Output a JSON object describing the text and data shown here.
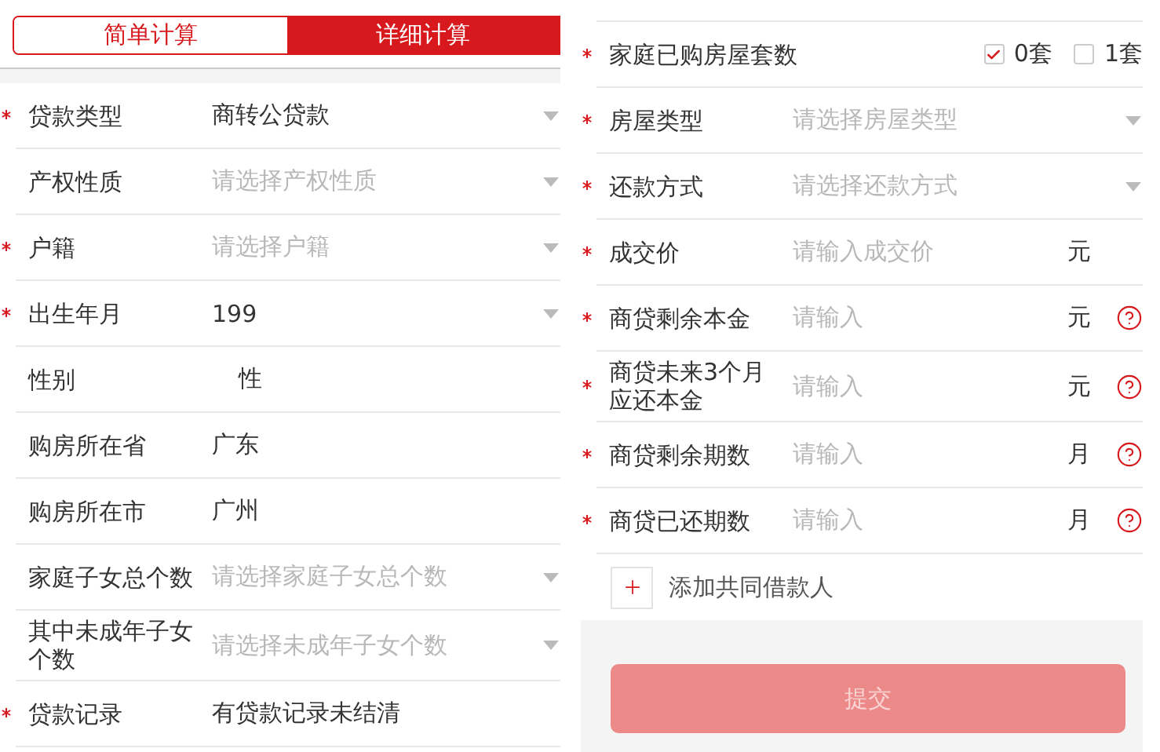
{
  "tabs": [
    {
      "label": "简单计算",
      "selected": false
    },
    {
      "label": "详细计算",
      "selected": true
    }
  ],
  "left_fields": [
    {
      "kind": "select",
      "required": true,
      "label": "贷款类型",
      "value": "商转公贷款",
      "arrow": true
    },
    {
      "kind": "select",
      "required": false,
      "label": "产权性质",
      "placeholder": "请选择产权性质",
      "arrow": true
    },
    {
      "kind": "select",
      "required": true,
      "label": "户籍",
      "placeholder": "请选择户籍",
      "arrow": true
    },
    {
      "kind": "select",
      "required": true,
      "label": "出生年月",
      "value": "199",
      "arrow": true
    },
    {
      "kind": "indented",
      "required": false,
      "label": "性别",
      "value": "性",
      "arrow": false
    },
    {
      "kind": "select",
      "required": false,
      "label": "购房所在省",
      "value": "广东",
      "arrow": false
    },
    {
      "kind": "select",
      "required": false,
      "label": "购房所在市",
      "value": "广州",
      "arrow": false
    },
    {
      "kind": "select",
      "required": false,
      "label": "家庭子女总个数",
      "placeholder": "请选择家庭子女总个数",
      "arrow": true
    },
    {
      "kind": "select",
      "required": false,
      "label": "其中未成年子女个数",
      "placeholder": "请选择未成年子女个数",
      "arrow": true
    },
    {
      "kind": "select",
      "required": true,
      "label": "贷款记录",
      "value": "有贷款记录未结清",
      "arrow": false
    }
  ],
  "right_fields": [
    {
      "kind": "checkbox_group",
      "required": true,
      "label": "家庭已购房屋套数",
      "options": [
        {
          "label": "0套",
          "checked": true
        },
        {
          "label": "1套",
          "checked": false
        }
      ]
    },
    {
      "kind": "select",
      "required": true,
      "label": "房屋类型",
      "placeholder": "请选择房屋类型",
      "arrow": true
    },
    {
      "kind": "select",
      "required": true,
      "label": "还款方式",
      "placeholder": "请选择还款方式",
      "arrow": true
    },
    {
      "kind": "input",
      "required": true,
      "label": "成交价",
      "placeholder": "请输入成交价",
      "unit": "元",
      "help": false
    },
    {
      "kind": "input",
      "required": true,
      "label": "商贷剩余本金",
      "placeholder": "请输入",
      "unit": "元",
      "help": true
    },
    {
      "kind": "input",
      "required": true,
      "label": "商贷未来3个月应还本金",
      "placeholder": "请输入",
      "unit": "元",
      "help": true
    },
    {
      "kind": "input",
      "required": true,
      "label": "商贷剩余期数",
      "placeholder": "请输入",
      "unit": "月",
      "help": true
    },
    {
      "kind": "input",
      "required": true,
      "label": "商贷已还期数",
      "placeholder": "请输入",
      "unit": "月",
      "help": true
    }
  ],
  "add_coborrower": {
    "label": "添加共同借款人"
  },
  "submit": {
    "label": "提交",
    "disabled": true
  }
}
